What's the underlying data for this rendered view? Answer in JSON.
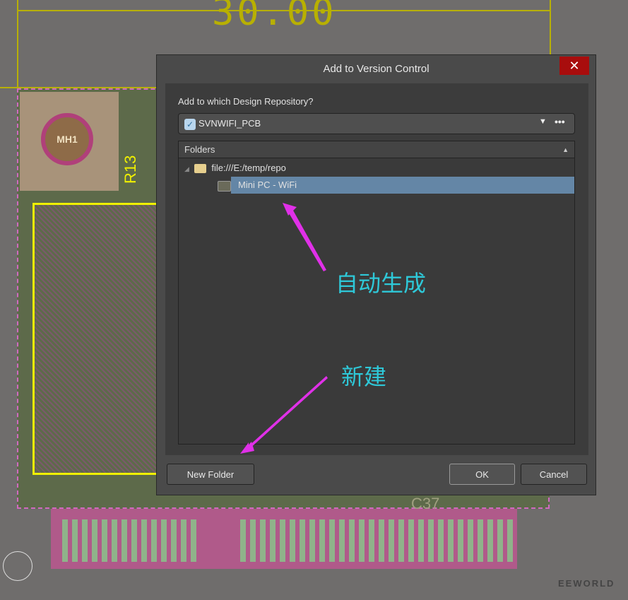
{
  "background": {
    "dimension_label": "30.00",
    "mounting_hole": "MH1",
    "silk_label": "R13",
    "silk_label2": "C37",
    "watermark": "EEWORLD"
  },
  "dialog": {
    "title": "Add to Version Control",
    "close_icon": "close-icon",
    "question": "Add to which Design Repository?",
    "repository": {
      "selected": "SVNWIFI_PCB",
      "more": "•••"
    },
    "folders": {
      "header": "Folders",
      "items": [
        {
          "label": "file:///E:/temp/repo",
          "level": 0,
          "expanded": true
        },
        {
          "label": "Mini PC - WiFi",
          "level": 1,
          "selected": true
        }
      ]
    },
    "buttons": {
      "new_folder": "New Folder",
      "ok": "OK",
      "cancel": "Cancel"
    }
  },
  "annotations": {
    "auto_generated": "自动生成",
    "new": "新建"
  },
  "colors": {
    "accent_selection": "#6486a6",
    "close": "#a80d0d",
    "annotation_text": "#2ec8d8",
    "annotation_arrow": "#e030e8"
  }
}
